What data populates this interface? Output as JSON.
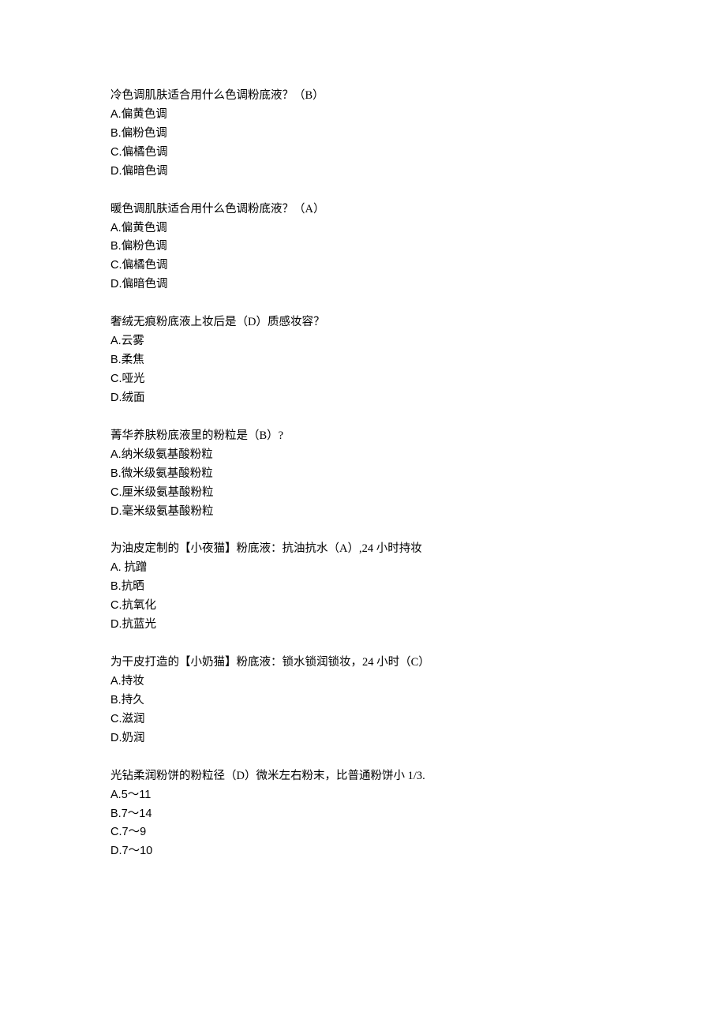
{
  "questions": [
    {
      "text": "冷色调肌肤适合用什么色调粉底液？（B）",
      "options": [
        {
          "letter": "A.",
          "text": "偏黄色调"
        },
        {
          "letter": "B.",
          "text": "偏粉色调"
        },
        {
          "letter": "C.",
          "text": "偏橘色调"
        },
        {
          "letter": "D.",
          "text": "偏暗色调"
        }
      ]
    },
    {
      "text": "暖色调肌肤适合用什么色调粉底液？（A）",
      "options": [
        {
          "letter": "A.",
          "text": "偏黄色调"
        },
        {
          "letter": "B.",
          "text": "偏粉色调"
        },
        {
          "letter": "C.",
          "text": "偏橘色调"
        },
        {
          "letter": "D.",
          "text": "偏暗色调"
        }
      ]
    },
    {
      "text": "奢绒无痕粉底液上妆后是（D）质感妆容？",
      "options": [
        {
          "letter": "A.",
          "text": "云雾"
        },
        {
          "letter": "B.",
          "text": "柔焦"
        },
        {
          "letter": "C.",
          "text": "哑光"
        },
        {
          "letter": "D.",
          "text": "绒面"
        }
      ]
    },
    {
      "text": "菁华养肤粉底液里的粉粒是（B）?",
      "options": [
        {
          "letter": "A.",
          "text": "纳米级氨基酸粉粒"
        },
        {
          "letter": "B.",
          "text": "微米级氨基酸粉粒"
        },
        {
          "letter": "C.",
          "text": "厘米级氨基酸粉粒"
        },
        {
          "letter": "D.",
          "text": "毫米级氨基酸粉粒"
        }
      ]
    },
    {
      "text": "为油皮定制的【小夜猫】粉底液：抗油抗水（A）,24 小时持妆",
      "options": [
        {
          "letter": "A.",
          "text": " 抗蹭"
        },
        {
          "letter": "B.",
          "text": "抗晒"
        },
        {
          "letter": "C.",
          "text": "抗氧化"
        },
        {
          "letter": "D.",
          "text": "抗蓝光"
        }
      ]
    },
    {
      "text": "为干皮打造的【小奶猫】粉底液：锁水锁润锁妆，24 小时（C）",
      "options": [
        {
          "letter": "A.",
          "text": "持妆"
        },
        {
          "letter": "B.",
          "text": "持久"
        },
        {
          "letter": "C.",
          "text": "滋润"
        },
        {
          "letter": "D.",
          "text": "奶润"
        }
      ]
    },
    {
      "text": "光钻柔润粉饼的粉粒径（D）微米左右粉末，比普通粉饼小 1/3.",
      "options": [
        {
          "letter": "A.",
          "text": "5～11"
        },
        {
          "letter": "B.",
          "text": "7～14"
        },
        {
          "letter": "C.",
          "text": "7～9"
        },
        {
          "letter": "D.",
          "text": "7～10"
        }
      ]
    }
  ]
}
